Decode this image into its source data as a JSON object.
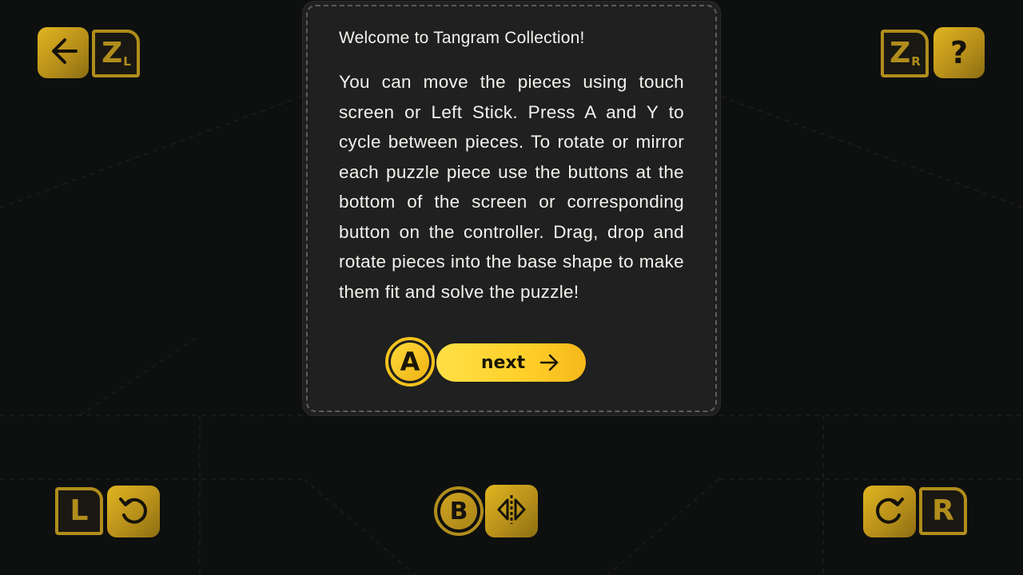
{
  "dialog": {
    "title": "Welcome to Tangram Collection!",
    "body": "You can move the pieces using touch screen or Left Stick. Press A and Y to cycle between pieces. To rotate or mirror each puzzle piece use the buttons at the bottom of the screen or corresponding button on the controller. Drag, drop and rotate pieces into the base shape to make them fit and solve the puzzle!",
    "next_key": "A",
    "next_label": "next"
  },
  "top_left": {
    "back_icon": "arrow-left-icon",
    "key_main": "Z",
    "key_sub": "L"
  },
  "top_right": {
    "key_main": "Z",
    "key_sub": "R",
    "help_label": "?"
  },
  "bottom_left": {
    "key": "L",
    "icon": "rotate-left-icon"
  },
  "bottom_center": {
    "key": "B",
    "icon": "mirror-icon"
  },
  "bottom_right": {
    "key": "R",
    "icon": "rotate-right-icon"
  },
  "colors": {
    "background": "#0e0f0f",
    "panel": "#1f201f",
    "accent_gold": "#c9a020",
    "accent_yellow": "#ffd530"
  }
}
